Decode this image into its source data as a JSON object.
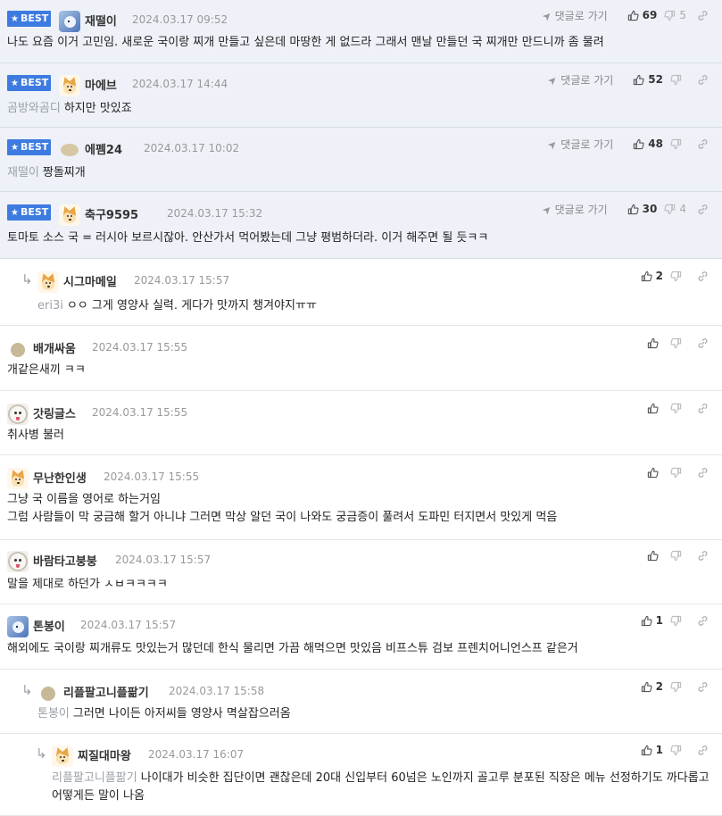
{
  "ui": {
    "best_label": "BEST",
    "goto_label": "댓글로 가기"
  },
  "colors": {
    "best_background": "#eef1f8",
    "best_badge": "#3d7be0",
    "mention": "#9aa0a8",
    "date": "#999999"
  },
  "comments": [
    {
      "best": true,
      "avatar": "fox-icon",
      "nick": "재떨이",
      "date": "2024.03.17 09:52",
      "mention": "",
      "lines": [
        "나도 요즘 이거 고민임. 새로운 국이랑 찌개 만들고 싶은데 마땅한 게 없드라 그래서 맨날 만들던 국 찌개만 만드니까 좀 물려"
      ],
      "up": "69",
      "down": "5"
    },
    {
      "best": true,
      "avatar": "dog-icon",
      "nick": "마에브",
      "date": "2024.03.17 14:44",
      "mention": "곰방와곰디",
      "lines": [
        "하지만 맛있죠"
      ],
      "up": "52",
      "down": ""
    },
    {
      "best": true,
      "avatar": "blob-icon",
      "nick": "에펨24",
      "date": "2024.03.17 10:02",
      "mention": "재떨이",
      "lines": [
        "짱돌찌개"
      ],
      "up": "48",
      "down": ""
    },
    {
      "best": true,
      "avatar": "dog-icon",
      "nick": "축구9595",
      "date": "2024.03.17 15:32",
      "mention": "",
      "lines": [
        "토마토 소스 국 = 러시아 보르시잖아. 안산가서 먹어봤는데 그냥 평범하더라. 이거 해주면 될 듯ㅋㅋ"
      ],
      "up": "30",
      "down": "4"
    },
    {
      "best": false,
      "depth": 1,
      "avatar": "dog-icon",
      "nick": "시그마메일",
      "date": "2024.03.17 15:57",
      "mention": "eri3i",
      "lines": [
        "ㅇㅇ 그게 영양사 실력. 게다가 맛까지 챙겨야지ㅠㅠ"
      ],
      "up": "2",
      "down": ""
    },
    {
      "best": false,
      "depth": 0,
      "avatar": "dot-icon",
      "nick": "배개싸움",
      "date": "2024.03.17 15:55",
      "mention": "",
      "lines": [
        "개같은새끼 ㅋㅋ"
      ],
      "up": "",
      "down": ""
    },
    {
      "best": false,
      "depth": 0,
      "avatar": "poodle-icon",
      "nick": "갓링글스",
      "date": "2024.03.17 15:55",
      "mention": "",
      "lines": [
        "취사병 불러"
      ],
      "up": "",
      "down": ""
    },
    {
      "best": false,
      "depth": 0,
      "avatar": "dog-icon",
      "nick": "무난한인생",
      "date": "2024.03.17 15:55",
      "mention": "",
      "lines": [
        "그냥 국 이름을 영어로 하는거임",
        "그럼 사람들이 막 궁금해 할거 아니냐 그러면 막상 알던 국이 나와도 궁금증이 풀려서 도파민 터지면서 맛있게 먹음"
      ],
      "up": "",
      "down": ""
    },
    {
      "best": false,
      "depth": 0,
      "avatar": "poodle-icon",
      "nick": "바람타고붕붕",
      "date": "2024.03.17 15:57",
      "mention": "",
      "lines": [
        "말을 제대로 하던가 ㅅㅂㅋㅋㅋㅋ"
      ],
      "up": "",
      "down": ""
    },
    {
      "best": false,
      "depth": 0,
      "avatar": "fox-icon",
      "nick": "톤봉이",
      "date": "2024.03.17 15:57",
      "mention": "",
      "lines": [
        "해외에도 국이랑 찌개류도 맛있는거 많던데 한식 물리면 가끔 해먹으면 맛있음 비프스튜 검보 프렌치어니언스프 같은거"
      ],
      "up": "1",
      "down": ""
    },
    {
      "best": false,
      "depth": 1,
      "avatar": "dot-icon",
      "nick": "리플팔고니플팖기",
      "date": "2024.03.17 15:58",
      "mention": "톤봉이",
      "lines": [
        "그러면 나이든 아저씨들 영양사 멱살잡으러옴"
      ],
      "up": "2",
      "down": ""
    },
    {
      "best": false,
      "depth": 2,
      "avatar": "dog-icon",
      "nick": "찌질대마왕",
      "date": "2024.03.17 16:07",
      "mention": "리플팔고니플팖기",
      "lines": [
        "나이대가 비슷한 집단이면 괜찮은데 20대 신입부터 60넘은 노인까지 골고루 분포된 직장은 메뉴 선정하기도 까다롭고 어떻게든 말이 나옴"
      ],
      "up": "1",
      "down": ""
    }
  ]
}
